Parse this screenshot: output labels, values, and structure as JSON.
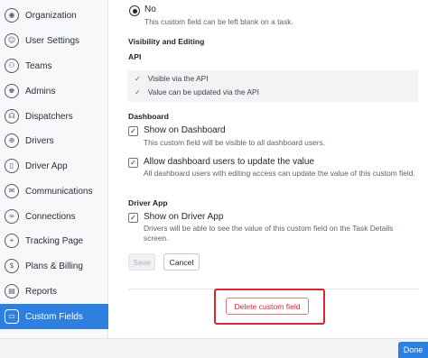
{
  "sidebar": {
    "items": [
      {
        "label": "Organization",
        "icon": "organization-icon",
        "glyph": "◉"
      },
      {
        "label": "User Settings",
        "icon": "user-icon",
        "glyph": "☺"
      },
      {
        "label": "Teams",
        "icon": "teams-icon",
        "glyph": "⚇"
      },
      {
        "label": "Admins",
        "icon": "admins-icon",
        "glyph": "♚"
      },
      {
        "label": "Dispatchers",
        "icon": "headset-icon",
        "glyph": "☊"
      },
      {
        "label": "Drivers",
        "icon": "steering-wheel-icon",
        "glyph": "⊕"
      },
      {
        "label": "Driver App",
        "icon": "phone-icon",
        "glyph": "▯"
      },
      {
        "label": "Communications",
        "icon": "chat-icon",
        "glyph": "✉"
      },
      {
        "label": "Connections",
        "icon": "connections-icon",
        "glyph": "∞"
      },
      {
        "label": "Tracking Page",
        "icon": "tracking-icon",
        "glyph": "⌖"
      },
      {
        "label": "Plans & Billing",
        "icon": "dollar-icon",
        "glyph": "$"
      },
      {
        "label": "Reports",
        "icon": "reports-icon",
        "glyph": "▤"
      },
      {
        "label": "Custom Fields",
        "icon": "custom-fields-icon",
        "glyph": "▭"
      }
    ],
    "active_index": 12
  },
  "form": {
    "required_option": {
      "label": "No",
      "selected": true,
      "help": "This custom field can be left blank on a task."
    },
    "visibility_heading": "Visibility and Editing",
    "api": {
      "heading": "API",
      "items": [
        "Visible via the API",
        "Value can be updated via the API"
      ]
    },
    "dashboard": {
      "heading": "Dashboard",
      "show": {
        "label": "Show on Dashboard",
        "checked": true,
        "help": "This custom field will be visible to all dashboard users."
      },
      "allow_update": {
        "label": "Allow dashboard users to update the value",
        "checked": true,
        "help": "All dashboard users with editing access can update the value of this custom field."
      }
    },
    "driver_app": {
      "heading": "Driver App",
      "show": {
        "label": "Show on Driver App",
        "checked": true,
        "help": "Drivers will be able to see the value of this custom field on the Task Details screen."
      }
    },
    "save_label": "Save",
    "cancel_label": "Cancel",
    "delete_label": "Delete custom field"
  },
  "footer": {
    "done_label": "Done"
  },
  "colors": {
    "accent": "#2d7fe0",
    "danger": "#d7262e"
  }
}
